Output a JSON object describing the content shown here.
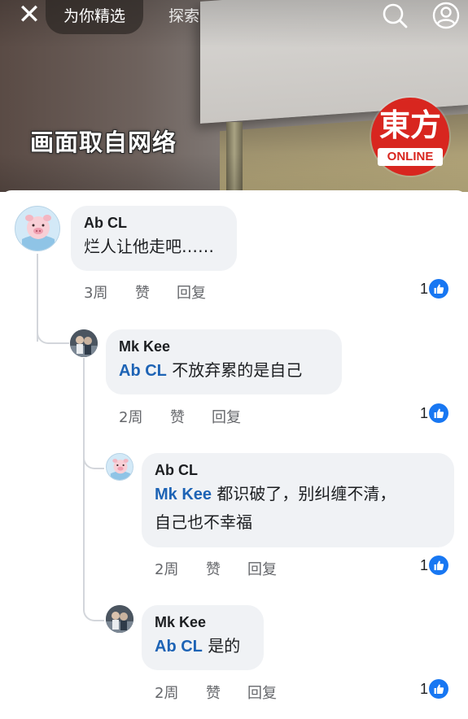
{
  "header": {
    "close_glyph": "✕",
    "tab_active": "为你精选",
    "tab_explore": "探索",
    "search_icon": "search-icon",
    "profile_icon": "profile-icon"
  },
  "video": {
    "caption": "画面取自网络",
    "logo_mark": "東方",
    "logo_word": "ONLINE",
    "logo_color": "#d8261f"
  },
  "colors": {
    "mention": "#1d63b5",
    "like": "#1877f2",
    "bubble": "#f0f2f5",
    "meta": "#65676b"
  },
  "comments": [
    {
      "author": "Ab CL",
      "text": "烂人让他走吧……",
      "time": "3周",
      "like_label": "赞",
      "reply_label": "回复",
      "reactions": "1"
    },
    {
      "author": "Mk Kee",
      "mention": "Ab CL",
      "text": "不放弃累的是自己",
      "time": "2周",
      "like_label": "赞",
      "reply_label": "回复",
      "reactions": "1"
    },
    {
      "author": "Ab CL",
      "mention": "Mk Kee",
      "text": "都识破了，别纠缠不清，",
      "text_line2": "自己也不幸福",
      "time": "2周",
      "like_label": "赞",
      "reply_label": "回复",
      "reactions": "1"
    },
    {
      "author": "Mk Kee",
      "mention": "Ab CL",
      "text": "是的",
      "time": "2周",
      "like_label": "赞",
      "reply_label": "回复",
      "reactions": "1"
    }
  ]
}
